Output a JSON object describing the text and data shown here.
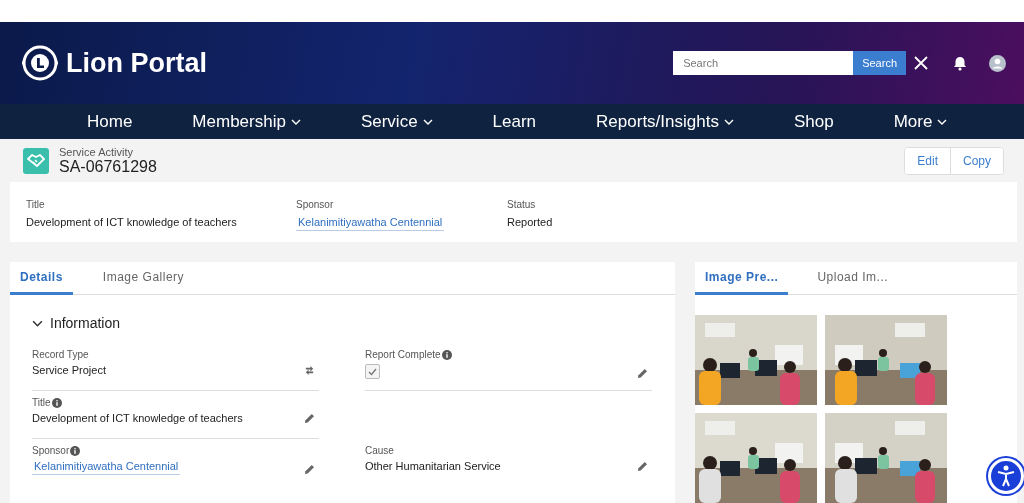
{
  "header": {
    "logo_text": "Lion Portal",
    "search": {
      "placeholder": "Search",
      "button": "Search"
    }
  },
  "nav": [
    {
      "label": "Home",
      "dropdown": false
    },
    {
      "label": "Membership",
      "dropdown": true
    },
    {
      "label": "Service",
      "dropdown": true
    },
    {
      "label": "Learn",
      "dropdown": false
    },
    {
      "label": "Reports/Insights",
      "dropdown": true
    },
    {
      "label": "Shop",
      "dropdown": false
    },
    {
      "label": "More",
      "dropdown": true
    }
  ],
  "record": {
    "type": "Service Activity",
    "id": "SA-06761298",
    "actions": [
      "Edit",
      "Copy"
    ]
  },
  "highlights": [
    {
      "label": "Title",
      "value": "Development of ICT knowledge of teachers",
      "kind": "text"
    },
    {
      "label": "Sponsor",
      "value": "Kelanimitiyawatha Centennial",
      "kind": "link"
    },
    {
      "label": "Status",
      "value": "Reported",
      "kind": "text"
    }
  ],
  "detail_tabs": [
    {
      "label": "Details",
      "selected": true
    },
    {
      "label": "Image Gallery",
      "selected": false
    }
  ],
  "section": {
    "title": "Information",
    "expanded": true
  },
  "field_rows": [
    {
      "left": {
        "label": "Record Type",
        "info": false,
        "kind": "text",
        "value": "Service Project",
        "button": {
          "kind": "change"
        }
      },
      "right": {
        "label": "Report Complete",
        "info": true,
        "kind": "checkbox",
        "checked": true,
        "button": {
          "kind": "edit"
        }
      }
    },
    {
      "left": {
        "label": "Title",
        "info": true,
        "kind": "text",
        "value": "Development of ICT knowledge of teachers",
        "button": {
          "kind": "edit"
        }
      }
    },
    {
      "left": {
        "label": "Sponsor",
        "info": true,
        "kind": "link",
        "value": "Kelanimitiyawatha Centennial",
        "button": {
          "kind": "edit"
        }
      },
      "right": {
        "label": "Cause",
        "info": false,
        "kind": "text",
        "value": "Other Humanitarian Service",
        "button": {
          "kind": "edit"
        }
      }
    }
  ],
  "gallery_tabs": [
    {
      "label": "Image Pre...",
      "selected": true
    },
    {
      "label": "Upload Im...",
      "selected": false
    }
  ]
}
